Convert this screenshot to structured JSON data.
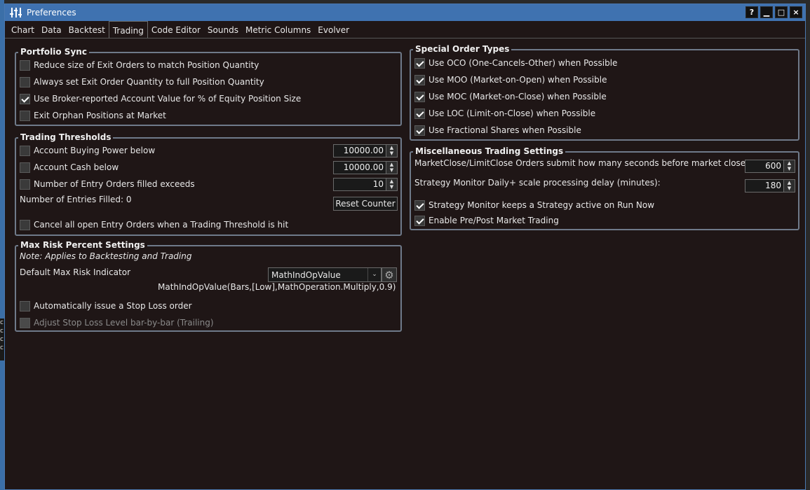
{
  "window": {
    "title": "Preferences",
    "help": "?",
    "minimize": "▁",
    "maximize": "□",
    "close": "×"
  },
  "tabs": [
    "Chart",
    "Data",
    "Backtest",
    "Trading",
    "Code Editor",
    "Sounds",
    "Metric Columns",
    "Evolver"
  ],
  "portfolio_sync": {
    "title": "Portfolio Sync",
    "items": [
      {
        "label": "Reduce size of Exit Orders to match Position Quantity",
        "checked": false
      },
      {
        "label": "Always set Exit Order Quantity to full Position Quantity",
        "checked": false
      },
      {
        "label": "Use Broker-reported Account Value for % of Equity Position Size",
        "checked": true
      },
      {
        "label": "Exit Orphan Positions at Market",
        "checked": false
      }
    ]
  },
  "trading_thresholds": {
    "title": "Trading Thresholds",
    "buying_power_label": "Account Buying Power below",
    "buying_power_value": "10000.00",
    "cash_label": "Account Cash below",
    "cash_value": "10000.00",
    "entry_orders_label": "Number of Entry Orders filled exceeds",
    "entry_orders_value": "10",
    "entries_filled": "Number of Entries Filled: 0",
    "reset_button": "Reset Counter",
    "cancel_label": "Cancel all open Entry Orders when a Trading Threshold is hit"
  },
  "max_risk": {
    "title": "Max Risk Percent Settings",
    "note": "Note: Applies to Backtesting and Trading",
    "indicator_label": "Default Max Risk Indicator",
    "indicator_value": "MathIndOpValue",
    "indicator_expr": "MathIndOpValue(Bars,[Low],MathOperation.Multiply,0.9)",
    "stop_loss_label": "Automatically issue a Stop Loss order",
    "trailing_label": "Adjust Stop Loss Level bar-by-bar (Trailing)"
  },
  "special_orders": {
    "title": "Special Order Types",
    "items": [
      {
        "label": "Use OCO (One-Cancels-Other) when Possible",
        "checked": true
      },
      {
        "label": "Use MOO (Market-on-Open) when Possible",
        "checked": true
      },
      {
        "label": "Use MOC (Market-on-Close) when Possible",
        "checked": true
      },
      {
        "label": "Use LOC (Limit-on-Close) when Possible",
        "checked": true
      },
      {
        "label": "Use Fractional Shares when Possible",
        "checked": true
      }
    ]
  },
  "misc": {
    "title": "Miscellaneous Trading Settings",
    "seconds_label": "MarketClose/LimitClose Orders submit how many seconds before market close:",
    "seconds_value": "600",
    "delay_label": "Strategy Monitor Daily+ scale processing delay (minutes):",
    "delay_value": "180",
    "keep_active_label": "Strategy Monitor keeps a Strategy active on Run Now",
    "prepost_label": "Enable Pre/Post Market Trading"
  },
  "edge_chars": [
    "c",
    "c",
    "c",
    "c"
  ]
}
